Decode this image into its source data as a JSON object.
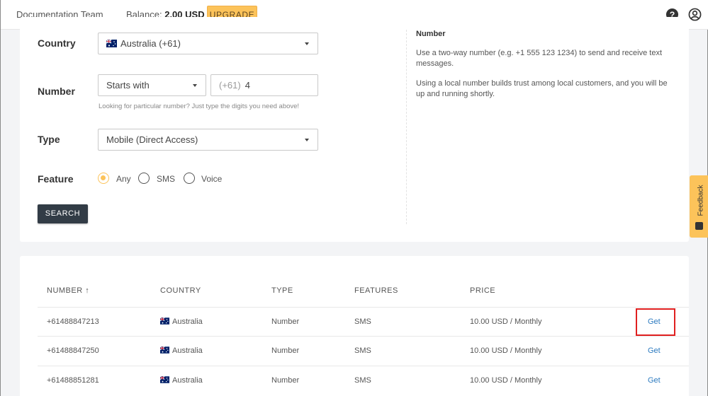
{
  "header": {
    "org_name": "Documentation Team",
    "balance_label": "Balance:",
    "balance_value": "2.00 USD",
    "upgrade_label": "UPGRADE"
  },
  "form": {
    "country_label": "Country",
    "country_value": "Australia (+61)",
    "number_label": "Number",
    "number_match": "Starts with",
    "number_prefix": "(+61)",
    "number_value": "4",
    "number_hint": "Looking for particular number? Just type the digits you need above!",
    "type_label": "Type",
    "type_value": "Mobile (Direct Access)",
    "feature_label": "Feature",
    "features": [
      "Any",
      "SMS",
      "Voice"
    ],
    "search_label": "SEARCH"
  },
  "info": {
    "title": "Number",
    "p1": "Use a two-way number (e.g. +1 555 123 1234) to send and receive text messages.",
    "p2": "Using a local number builds trust among local customers, and you will be up and running shortly."
  },
  "feedback_label": "Feedback",
  "table": {
    "headers": [
      "NUMBER ↑",
      "COUNTRY",
      "TYPE",
      "FEATURES",
      "PRICE"
    ],
    "rows": [
      {
        "number": "+61488847213",
        "country": "Australia",
        "type": "Number",
        "features": "SMS",
        "price": "10.00 USD / Monthly",
        "action": "Get"
      },
      {
        "number": "+61488847250",
        "country": "Australia",
        "type": "Number",
        "features": "SMS",
        "price": "10.00 USD / Monthly",
        "action": "Get"
      },
      {
        "number": "+61488851281",
        "country": "Australia",
        "type": "Number",
        "features": "SMS",
        "price": "10.00 USD / Monthly",
        "action": "Get"
      }
    ]
  },
  "colors": {
    "accent": "#fcc35a",
    "dark_button": "#323c46",
    "link": "#2d7bc0",
    "highlight": "#e02020"
  }
}
